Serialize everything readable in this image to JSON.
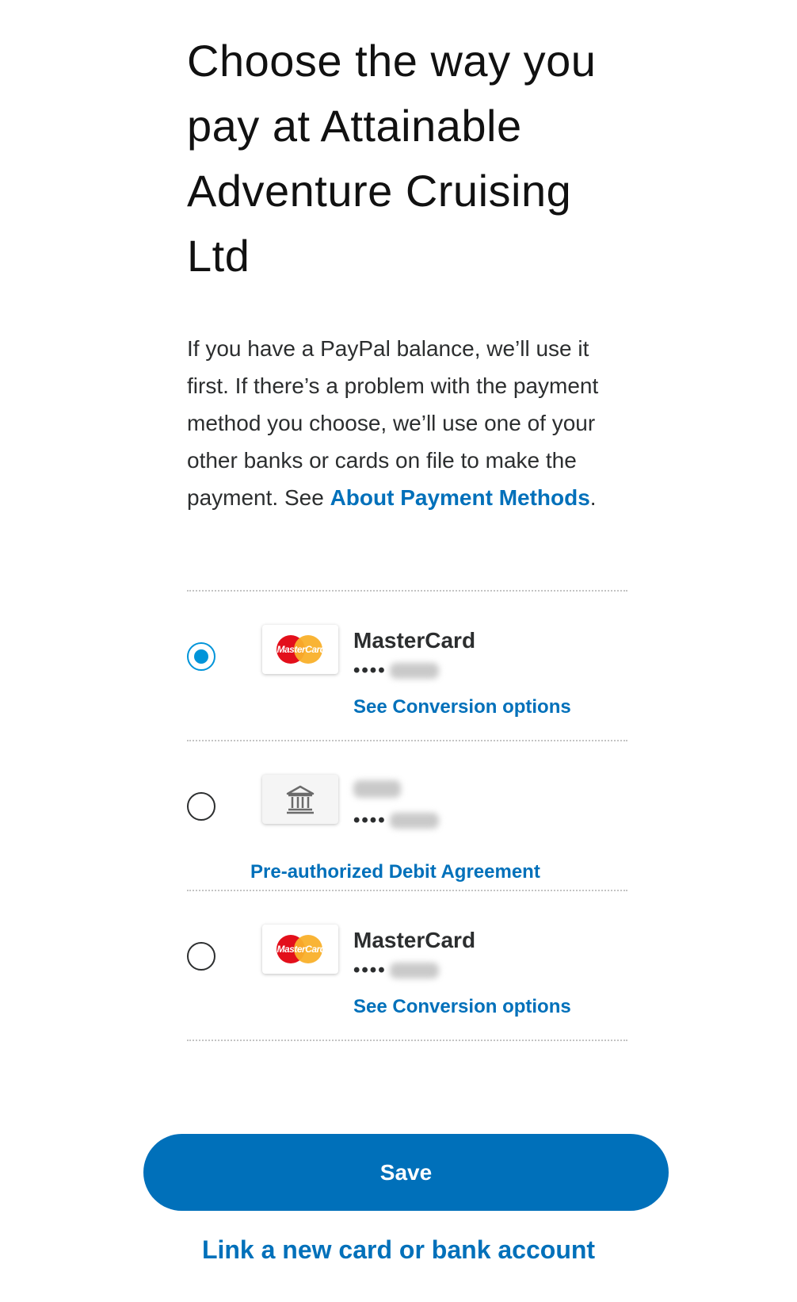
{
  "header": {
    "title": "Choose the way you pay at Attainable Adventure Cruising Ltd"
  },
  "description": {
    "text": "If you have a PayPal balance, we’ll use it first. If there’s a problem with the payment method you choose, we’ll use one of your other banks or cards on file to make the payment. See ",
    "link_label": "About Payment Methods",
    "suffix": "."
  },
  "payment_methods": [
    {
      "type": "card",
      "logo_text": "MasterCard",
      "name": "MasterCard",
      "masked": "••••",
      "link_label": "See Conversion options",
      "selected": true
    },
    {
      "type": "bank",
      "icon": "bank-icon",
      "masked": "••••",
      "link_label": "Pre-authorized Debit Agreement",
      "selected": false
    },
    {
      "type": "card",
      "logo_text": "MasterCard",
      "name": "MasterCard",
      "masked": "••••",
      "link_label": "See Conversion options",
      "selected": false
    }
  ],
  "actions": {
    "save_label": "Save",
    "link_new_label": "Link a new card or bank account"
  },
  "colors": {
    "accent": "#0070ba",
    "radio_selected": "#0094d9"
  }
}
